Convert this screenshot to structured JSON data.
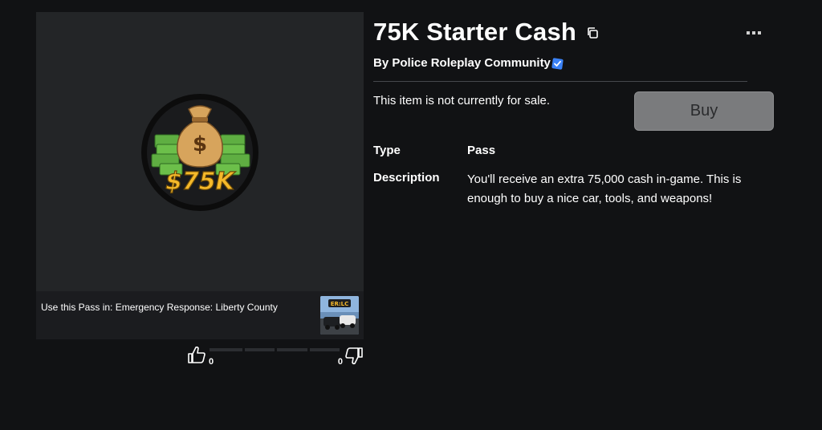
{
  "item": {
    "title": "75K Starter Cash",
    "by_prefix": "By",
    "creator": "Police Roleplay Community",
    "sale_status": "This item is not currently for sale.",
    "buy_label": "Buy",
    "type_label": "Type",
    "type_value": "Pass",
    "description_label": "Description",
    "description_value": "You'll receive an extra 75,000 cash in-game. This is enough to buy a nice car, tools, and weapons!"
  },
  "thumbnail": {
    "text": "$75K",
    "icon": "money-bag-icon"
  },
  "place": {
    "prefix": "Use this Pass in:",
    "name": "Emergency Response: Liberty County",
    "thumb_text": "ER:LC"
  },
  "votes": {
    "up": "0",
    "down": "0"
  },
  "colors": {
    "background": "#111214",
    "panel": "#232527",
    "buy_disabled": "#7a7b7d",
    "verified": "#3b82f6",
    "gold": "#f5b92a"
  }
}
